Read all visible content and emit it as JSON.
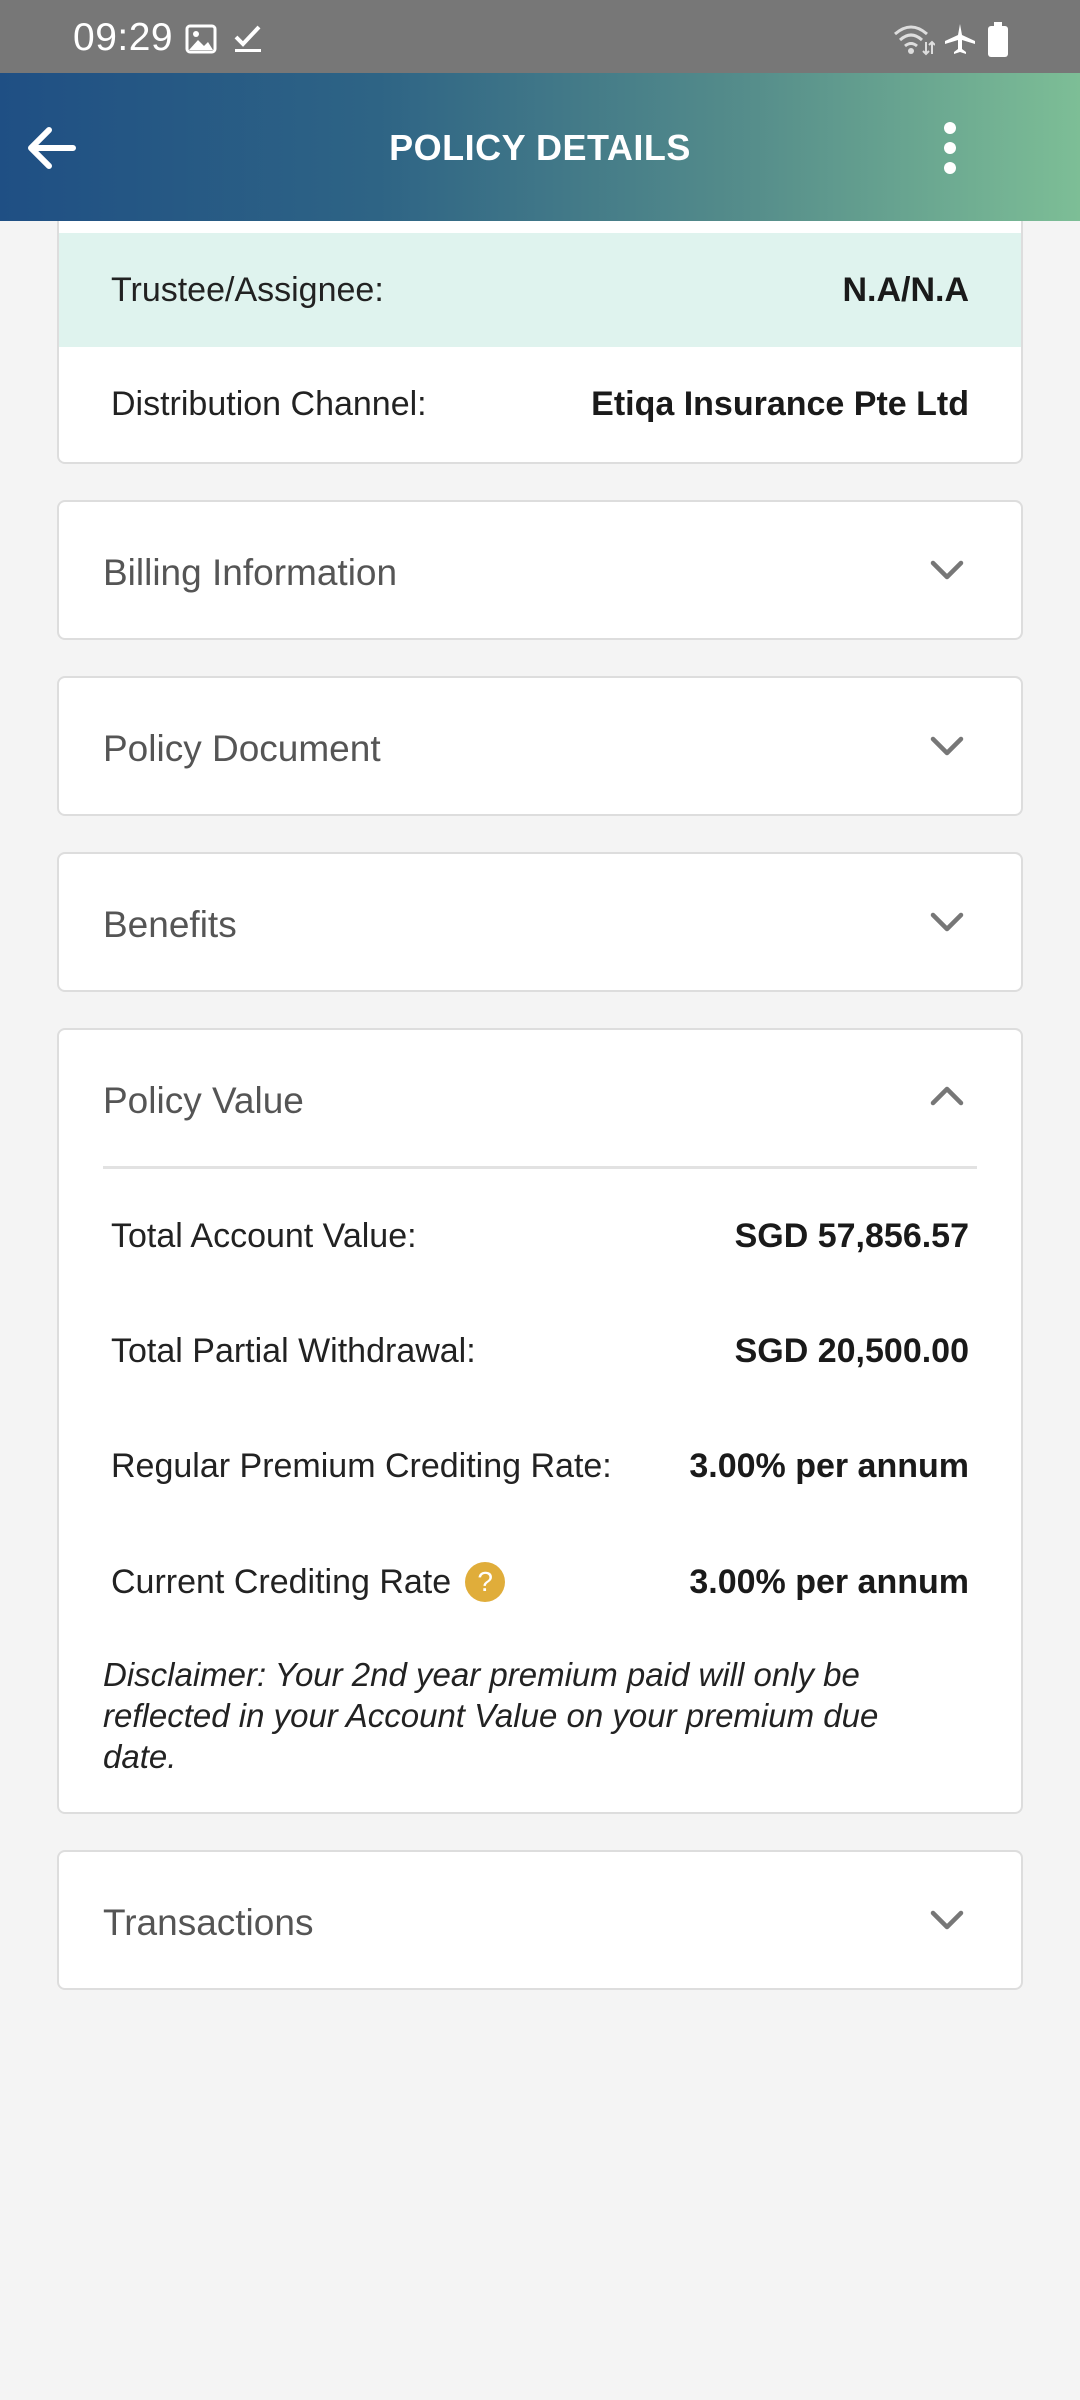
{
  "status_bar": {
    "time": "09:29",
    "left_icons": [
      "image-icon",
      "check-icon"
    ],
    "right_icons": [
      "wifi-icon",
      "airplane-icon",
      "battery-icon"
    ]
  },
  "header": {
    "title": "POLICY DETAILS",
    "back_icon": "arrow-left-icon",
    "menu_icon": "more-vertical-icon",
    "gradient_colors": [
      "#1f4f84",
      "#7dbe96"
    ]
  },
  "policy_info": {
    "rows": [
      {
        "label": "Trustee/Assignee:",
        "value": "N.A/N.A"
      },
      {
        "label": "Distribution Channel:",
        "value": "Etiqa Insurance Pte Ltd"
      }
    ]
  },
  "sections": {
    "billing": {
      "title": "Billing Information",
      "expanded": false
    },
    "policy_document": {
      "title": "Policy Document",
      "expanded": false
    },
    "benefits": {
      "title": "Benefits",
      "expanded": false
    },
    "policy_value": {
      "title": "Policy Value",
      "expanded": true,
      "rows": [
        {
          "label": "Total Account Value:",
          "value": "SGD 57,856.57"
        },
        {
          "label": "Total Partial Withdrawal:",
          "value": "SGD 20,500.00"
        },
        {
          "label": "Regular Premium Crediting Rate:",
          "value": "3.00% per annum"
        },
        {
          "label": "Current Crediting Rate",
          "value": "3.00% per annum",
          "help": "?"
        }
      ],
      "disclaimer": "Disclaimer: Your 2nd year premium paid will only be reflected in your Account Value on your premium due date."
    },
    "transactions": {
      "title": "Transactions",
      "expanded": false
    }
  },
  "colors": {
    "highlight_row": "#dff3ee",
    "help_badge": "#e0ad3a",
    "background": "#f4f4f4"
  }
}
